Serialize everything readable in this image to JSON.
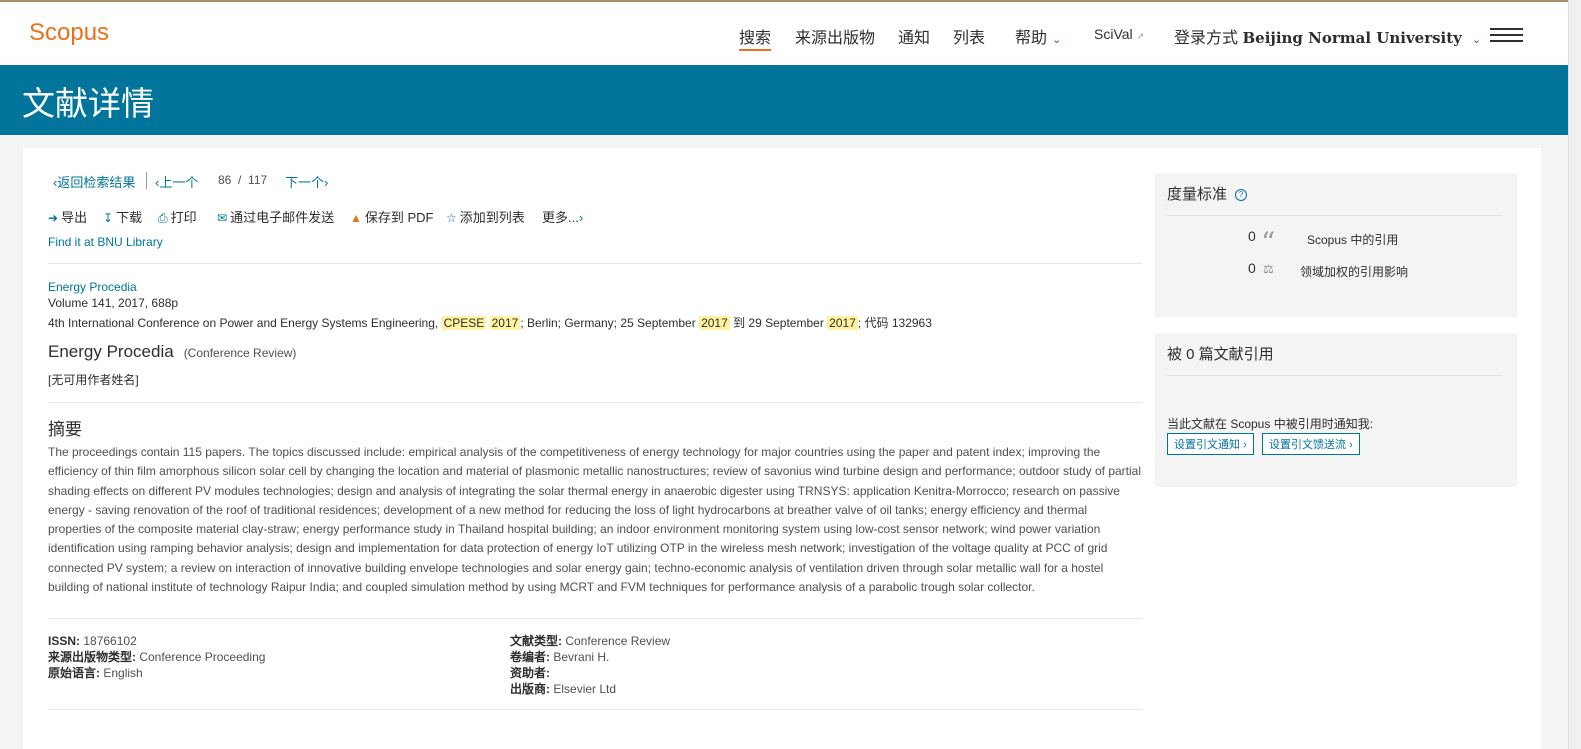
{
  "header": {
    "logo": "Scopus",
    "nav": {
      "search": "搜索",
      "sources": "来源出版物",
      "alerts": "通知",
      "lists": "列表",
      "help": "帮助",
      "scival": "SciVal",
      "login_prefix": "登录方式",
      "institution": "Beijing Normal University"
    }
  },
  "banner": {
    "title": "文献详情"
  },
  "pager": {
    "back": "返回检索结果",
    "prev": "上一个",
    "current": "86",
    "slash": "/",
    "total": "117",
    "next": "下一个"
  },
  "toolbar": {
    "export": "导出",
    "download": "下载",
    "print": "打印",
    "email": "通过电子邮件发送",
    "save_pdf": "保存到 PDF",
    "add_list": "添加到列表",
    "more": "更多..."
  },
  "findit": "Find it at BNU Library",
  "source": {
    "journal": "Energy Procedia",
    "volume": "Volume 141, 2017, 688p",
    "conf_parts": [
      "4th International Conference on Power and Energy Systems Engineering, ",
      "CPESE",
      "2017",
      "; Berlin; Germany; 25 September ",
      "2017",
      " 到 29 September ",
      "2017",
      "; 代码 132963"
    ]
  },
  "document": {
    "title": "Energy Procedia",
    "type": "(Conference Review)",
    "authors": "[无可用作者姓名]"
  },
  "abstract": {
    "heading": "摘要",
    "text": "The proceedings contain 115 papers. The topics discussed include: empirical analysis of the competitiveness of energy technology for major countries using the paper and patent index; improving the efficiency of thin film amorphous silicon solar cell by changing the location and material of plasmonic metallic nanostructures; review of savonius wind turbine design and performance; outdoor study of partial shading effects on different PV modules technologies; design and analysis of integrating the solar thermal energy in anaerobic digester using TRNSYS: application Kenitra-Morrocco; research on passive energy - saving renovation of the roof of traditional residences; development of a new method for reducing the loss of light hydrocarbons at breather valve of oil tanks; energy efficiency and thermal properties of the composite material clay-straw; energy performance study in Thailand hospital building; an indoor environment monitoring system using low-cost sensor network; wind power variation identification using ramping behavior analysis; design and implementation for data protection of energy IoT utilizing OTP in the wireless mesh network; investigation of the voltage quality at PCC of grid connected PV system; a review on interaction of innovative building envelope technologies and solar energy gain; techno-economic analysis of ventilation driven through solar metallic wall for a hostel building of national institute of technology Raipur India; and coupled simulation method by using MCRT and FVM techniques for performance analysis of a parabolic trough solar collector."
  },
  "meta": {
    "issn_label": "ISSN:",
    "issn": "18766102",
    "source_type_label": "来源出版物类型:",
    "source_type": "Conference Proceeding",
    "language_label": "原始语言:",
    "language": "English",
    "doc_type_label": "文献类型:",
    "doc_type": "Conference Review",
    "editor_label": "卷编者:",
    "editor": "Bevrani H.",
    "sponsor_label": "资助者:",
    "sponsor": "",
    "publisher_label": "出版商:",
    "publisher": "Elsevier Ltd"
  },
  "metrics": {
    "heading": "度量标准",
    "scopus_count": "0",
    "scopus_label": "Scopus 中的引用",
    "fwci_count": "0",
    "fwci_label": "领域加权的引用影响"
  },
  "cited_by": {
    "heading": "被 0 篇文献引用",
    "notify_text": "当此文献在 Scopus 中被引用时通知我:",
    "alert_btn": "设置引文通知",
    "feed_btn": "设置引文馈送流"
  },
  "colors": {
    "brand": "#e9711c",
    "primary": "#00749b",
    "highlight": "#fff3a1"
  }
}
